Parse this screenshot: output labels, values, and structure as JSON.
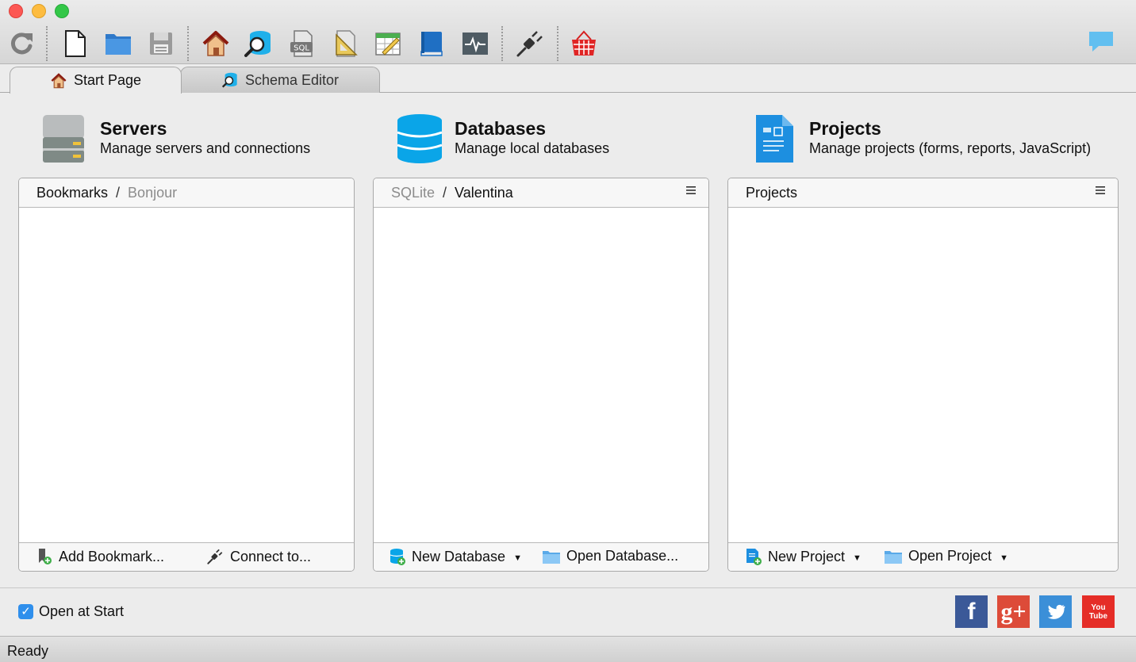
{
  "window": {
    "traffic_lights": {
      "close": "#fc5753",
      "minimize": "#fdbc40",
      "zoom": "#33c748"
    }
  },
  "toolbar": {
    "buttons": [
      {
        "name": "refresh-button",
        "icon": "refresh-icon"
      },
      {
        "name": "new-file-button",
        "icon": "document-icon"
      },
      {
        "name": "open-folder-button",
        "icon": "folder-icon"
      },
      {
        "name": "save-button",
        "icon": "save-icon"
      },
      {
        "name": "home-button",
        "icon": "home-icon"
      },
      {
        "name": "schema-editor-button",
        "icon": "database-search-icon"
      },
      {
        "name": "sql-editor-button",
        "icon": "sql-icon",
        "icon_text": "SQL"
      },
      {
        "name": "query-builder-button",
        "icon": "triangle-ruler-icon"
      },
      {
        "name": "data-editor-button",
        "icon": "table-edit-icon"
      },
      {
        "name": "documentation-button",
        "icon": "book-icon"
      },
      {
        "name": "monitor-button",
        "icon": "activity-icon"
      },
      {
        "name": "connect-button",
        "icon": "plug-icon"
      },
      {
        "name": "store-button",
        "icon": "basket-icon"
      }
    ],
    "chat_icon": "chat-bubble-icon"
  },
  "tabs": [
    {
      "label": "Start Page",
      "icon": "home-icon",
      "active": true
    },
    {
      "label": "Schema Editor",
      "icon": "database-search-icon",
      "active": false
    }
  ],
  "sections": {
    "servers": {
      "title": "Servers",
      "subtitle": "Manage servers and connections",
      "breadcrumb": {
        "first": "Bookmarks",
        "separator": "/",
        "second": "Bonjour"
      },
      "footer": {
        "add_bookmark": "Add Bookmark...",
        "connect": "Connect to..."
      }
    },
    "databases": {
      "title": "Databases",
      "subtitle": "Manage local databases",
      "breadcrumb": {
        "first": "SQLite",
        "separator": "/",
        "second": "Valentina"
      },
      "menu_icon": "≡",
      "footer": {
        "new_database": "New Database",
        "open_database": "Open Database..."
      }
    },
    "projects": {
      "title": "Projects",
      "subtitle": "Manage projects (forms, reports, JavaScript)",
      "header": "Projects",
      "menu_icon": "≡",
      "footer": {
        "new_project": "New Project",
        "open_project": "Open Project"
      }
    }
  },
  "open_at_start": {
    "label": "Open at Start",
    "checked": true,
    "mark": "✓"
  },
  "social": [
    {
      "name": "facebook",
      "glyph": "f",
      "color": "#3b5998"
    },
    {
      "name": "google-plus",
      "glyph": "g+",
      "color": "#dd4b39"
    },
    {
      "name": "twitter",
      "glyph": "t",
      "color": "#3b8fd8"
    },
    {
      "name": "youtube",
      "glyph": "You Tube",
      "color": "#e52d27"
    }
  ],
  "status": {
    "text": "Ready"
  }
}
